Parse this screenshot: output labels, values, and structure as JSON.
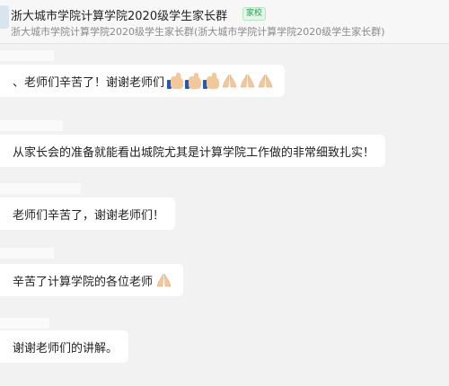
{
  "header": {
    "title": "浙大城市学院计算学院2020级学生家长群",
    "badge": "家校",
    "subtitle": "浙大城市学院计算学院2020级学生家长群(浙大城市学院计算学院2020级学生家长群)"
  },
  "messages": [
    {
      "text": "、老师们辛苦了！谢谢老师们",
      "emojis": [
        "thumbs-up-icon",
        "thumbs-up-icon",
        "thumbs-up-icon",
        "folded-hands-icon",
        "folded-hands-icon",
        "folded-hands-icon"
      ]
    },
    {
      "text": "从家长会的准备就能看出城院尤其是计算学院工作做的非常细致扎实！",
      "emojis": []
    },
    {
      "text": "老师们辛苦了，谢谢老师们！",
      "emojis": []
    },
    {
      "text": "辛苦了计算学院的各位老师",
      "emojis": [
        "folded-hands-icon"
      ]
    },
    {
      "text": "谢谢老师们的讲解。",
      "emojis": []
    }
  ]
}
